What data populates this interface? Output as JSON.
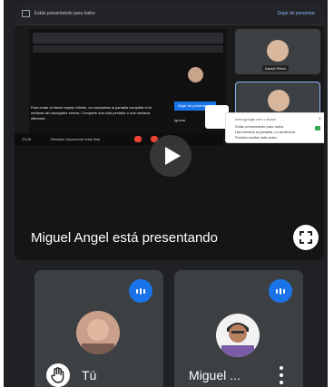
{
  "presentation": {
    "inner": {
      "topbar_message": "Estás presentando para todos",
      "stop_label": "Dejar de presentar",
      "stop_sharing_button": "Dejar de presentar",
      "ignore_label": "Ignorar",
      "warning_text": "Para evitar el efecto espejo infinito, no compartas la pantalla completa ni la ventana del navegador entera. Comparte una sola pestaña o una ventana diferente.",
      "taskbar_time": "23:08",
      "taskbar_doc": "Revision documento tesis final",
      "side_tile_name": "Daniel Pérez",
      "notification": {
        "title": "meet.google.com • ahora",
        "line1": "Estás presentando para todos",
        "line2": "Has iniciado la pantalla. La audiencia",
        "line3": "Puedes ocultar este aviso"
      }
    },
    "presenting_text": "Miguel Angel está presentando"
  },
  "participants": [
    {
      "name": "Tú"
    },
    {
      "name": "Miguel ..."
    }
  ],
  "colors": {
    "background": "#202124",
    "tile": "#3c4043",
    "accent": "#1a73e8"
  }
}
